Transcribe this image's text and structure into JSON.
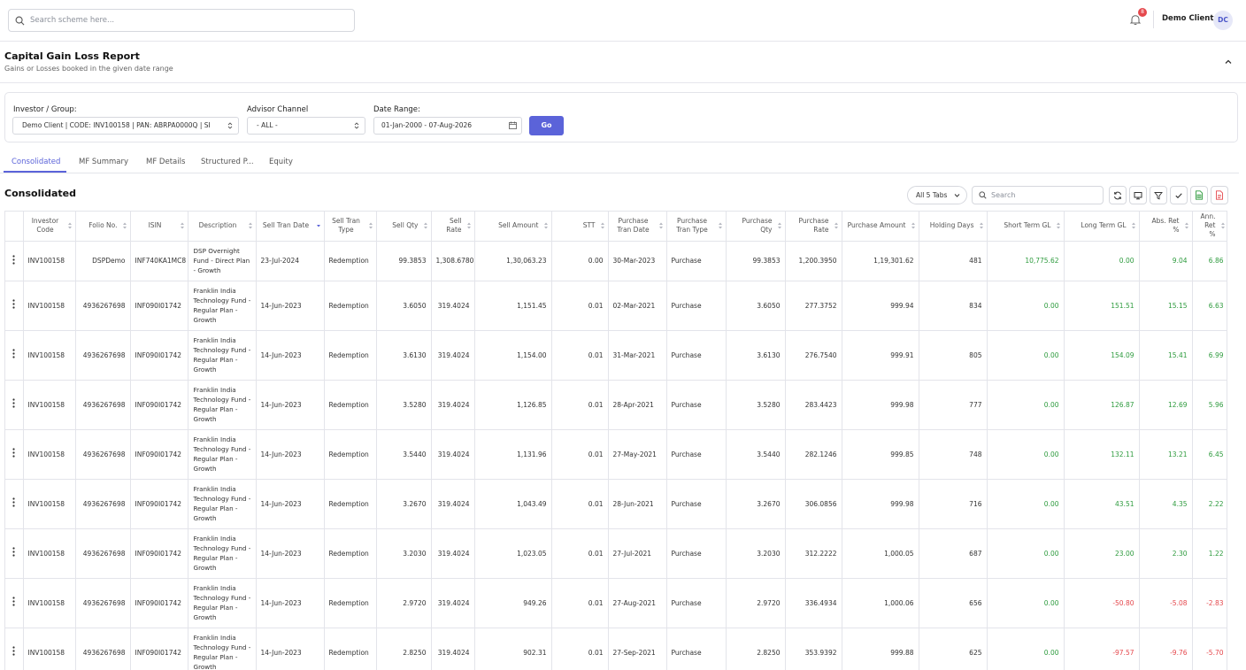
{
  "header": {
    "search_placeholder": "Search scheme here...",
    "notification_count": "8",
    "user_name": "Demo Client",
    "user_initials": "DC"
  },
  "page": {
    "title": "Capital Gain Loss Report",
    "subtitle": "Gains or Losses booked in the given date range"
  },
  "filters": {
    "investor_label": "Investor / Group:",
    "investor_value": "Demo Client | CODE: INV100158 | PAN: ABRPA0000Q | SI",
    "channel_label": "Advisor Channel",
    "channel_value": "- ALL -",
    "date_label": "Date Range:",
    "date_value": "01-Jan-2000 - 07-Aug-2026",
    "go_label": "Go"
  },
  "tabs": [
    "Consolidated",
    "MF Summary",
    "MF Details",
    "Structured P...",
    "Equity"
  ],
  "section": {
    "title": "Consolidated",
    "tab_selector": "All 5 Tabs",
    "search_placeholder": "Search"
  },
  "table": {
    "columns": [
      "",
      "Investor Code",
      "Folio No.",
      "ISIN",
      "Description",
      "Sell Tran Date",
      "Sell Tran Type",
      "Sell Qty",
      "Sell Rate",
      "Sell Amount",
      "STT",
      "Purchase Tran Date",
      "Purchase Tran Type",
      "Purchase Qty",
      "Purchase Rate",
      "Purchase Amount",
      "Holding Days",
      "Short Term GL",
      "Long Term GL",
      "Abs. Ret %",
      "Ann. Ret %"
    ],
    "rows": [
      [
        "INV100158",
        "DSPDemo",
        "INF740KA1MC8",
        "DSP Overnight Fund - Direct Plan - Growth",
        "23-Jul-2024",
        "Redemption",
        "99.3853",
        "1,308.6780",
        "1,30,063.23",
        "0.00",
        "30-Mar-2023",
        "Purchase",
        "99.3853",
        "1,200.3950",
        "1,19,301.62",
        "481",
        "10,775.62",
        "0.00",
        "9.04",
        "6.86"
      ],
      [
        "INV100158",
        "4936267698",
        "INF090I01742",
        "Franklin India Technology Fund - Regular Plan - Growth",
        "14-Jun-2023",
        "Redemption",
        "3.6050",
        "319.4024",
        "1,151.45",
        "0.01",
        "02-Mar-2021",
        "Purchase",
        "3.6050",
        "277.3752",
        "999.94",
        "834",
        "0.00",
        "151.51",
        "15.15",
        "6.63"
      ],
      [
        "INV100158",
        "4936267698",
        "INF090I01742",
        "Franklin India Technology Fund - Regular Plan - Growth",
        "14-Jun-2023",
        "Redemption",
        "3.6130",
        "319.4024",
        "1,154.00",
        "0.01",
        "31-Mar-2021",
        "Purchase",
        "3.6130",
        "276.7540",
        "999.91",
        "805",
        "0.00",
        "154.09",
        "15.41",
        "6.99"
      ],
      [
        "INV100158",
        "4936267698",
        "INF090I01742",
        "Franklin India Technology Fund - Regular Plan - Growth",
        "14-Jun-2023",
        "Redemption",
        "3.5280",
        "319.4024",
        "1,126.85",
        "0.01",
        "28-Apr-2021",
        "Purchase",
        "3.5280",
        "283.4423",
        "999.98",
        "777",
        "0.00",
        "126.87",
        "12.69",
        "5.96"
      ],
      [
        "INV100158",
        "4936267698",
        "INF090I01742",
        "Franklin India Technology Fund - Regular Plan - Growth",
        "14-Jun-2023",
        "Redemption",
        "3.5440",
        "319.4024",
        "1,131.96",
        "0.01",
        "27-May-2021",
        "Purchase",
        "3.5440",
        "282.1246",
        "999.85",
        "748",
        "0.00",
        "132.11",
        "13.21",
        "6.45"
      ],
      [
        "INV100158",
        "4936267698",
        "INF090I01742",
        "Franklin India Technology Fund - Regular Plan - Growth",
        "14-Jun-2023",
        "Redemption",
        "3.2670",
        "319.4024",
        "1,043.49",
        "0.01",
        "28-Jun-2021",
        "Purchase",
        "3.2670",
        "306.0856",
        "999.98",
        "716",
        "0.00",
        "43.51",
        "4.35",
        "2.22"
      ],
      [
        "INV100158",
        "4936267698",
        "INF090I01742",
        "Franklin India Technology Fund - Regular Plan - Growth",
        "14-Jun-2023",
        "Redemption",
        "3.2030",
        "319.4024",
        "1,023.05",
        "0.01",
        "27-Jul-2021",
        "Purchase",
        "3.2030",
        "312.2222",
        "1,000.05",
        "687",
        "0.00",
        "23.00",
        "2.30",
        "1.22"
      ],
      [
        "INV100158",
        "4936267698",
        "INF090I01742",
        "Franklin India Technology Fund - Regular Plan - Growth",
        "14-Jun-2023",
        "Redemption",
        "2.9720",
        "319.4024",
        "949.26",
        "0.01",
        "27-Aug-2021",
        "Purchase",
        "2.9720",
        "336.4934",
        "1,000.06",
        "656",
        "0.00",
        "-50.80",
        "-5.08",
        "-2.83"
      ],
      [
        "INV100158",
        "4936267698",
        "INF090I01742",
        "Franklin India Technology Fund - Regular Plan - Growth",
        "14-Jun-2023",
        "Redemption",
        "2.8250",
        "319.4024",
        "902.31",
        "0.01",
        "27-Sep-2021",
        "Purchase",
        "2.8250",
        "353.9392",
        "999.88",
        "625",
        "0.00",
        "-97.57",
        "-9.76",
        "-5.70"
      ]
    ]
  }
}
